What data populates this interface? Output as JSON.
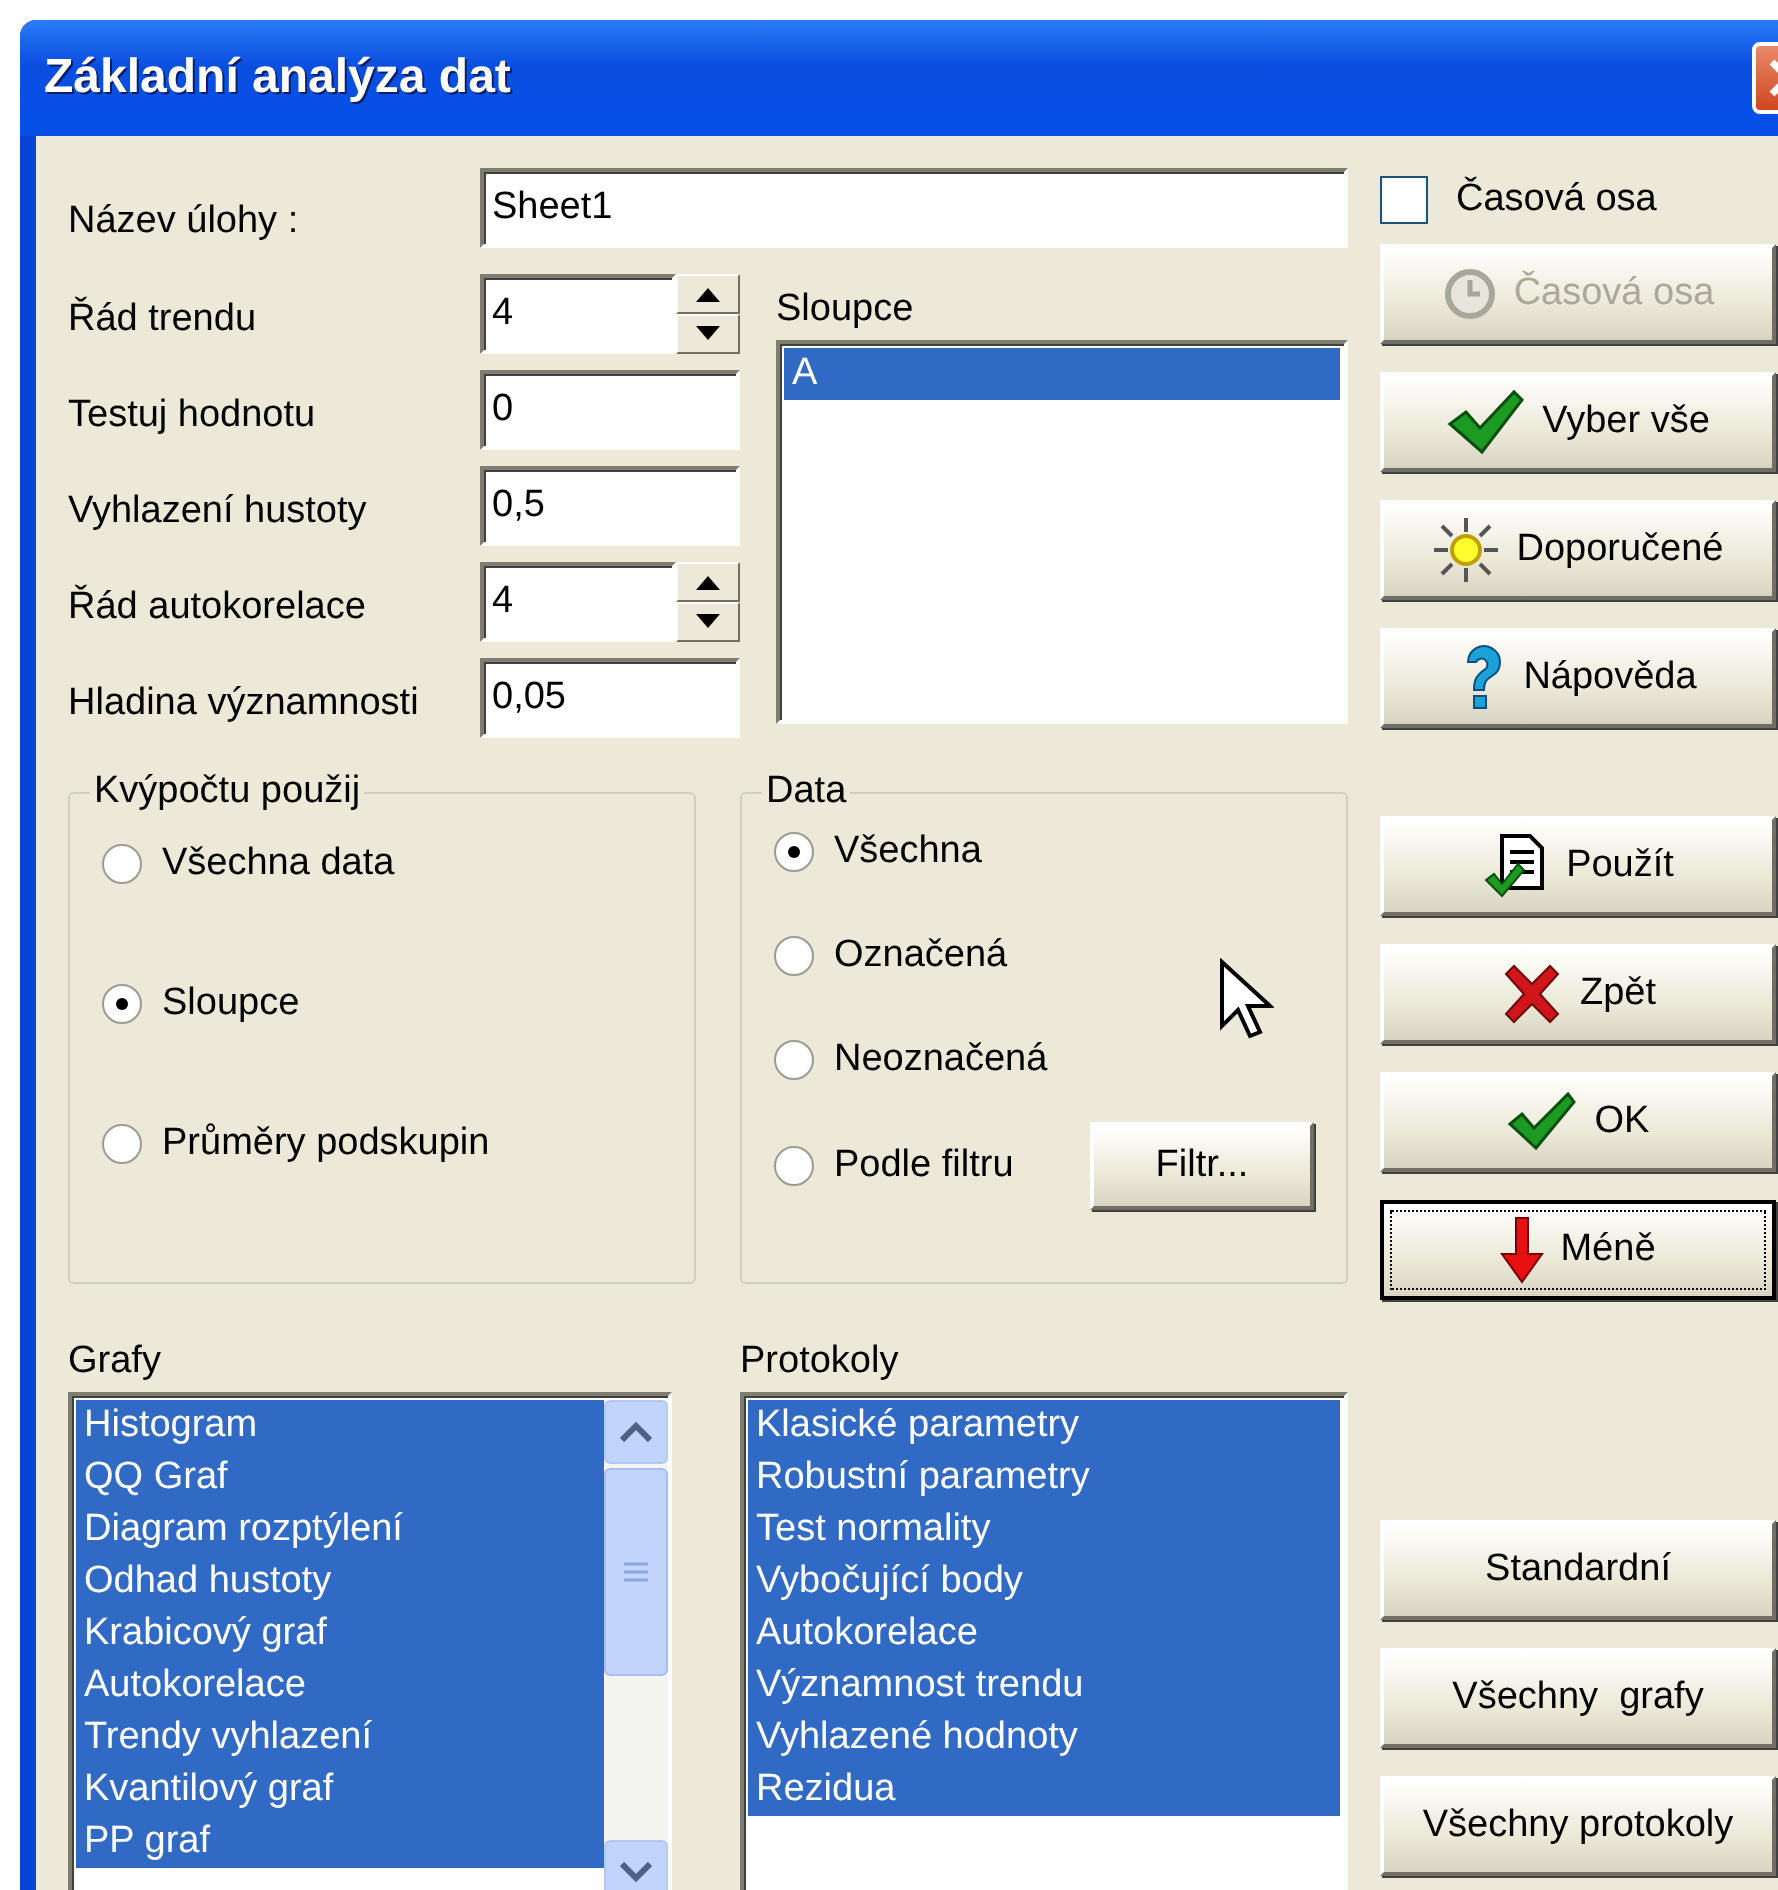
{
  "window": {
    "title": "Základní analýza dat"
  },
  "task_name": {
    "label": "Název úlohy :",
    "value": "Sheet1"
  },
  "fields": [
    {
      "label": "Řád trendu",
      "value": "4",
      "kind": "spin"
    },
    {
      "label": "Testuj hodnotu",
      "value": "0",
      "kind": "text"
    },
    {
      "label": "Vyhlazení hustoty",
      "value": "0,5",
      "kind": "text"
    },
    {
      "label": "Řád autokorelace",
      "value": "4",
      "kind": "spin"
    },
    {
      "label": "Hladina významnosti",
      "value": "0,05",
      "kind": "text"
    }
  ],
  "columns": {
    "label": "Sloupce",
    "items": [
      {
        "label": "A",
        "selected": true
      }
    ]
  },
  "compute_group": {
    "title": "Kvýpočtu použij",
    "options": [
      {
        "label": "Všechna data",
        "selected": false
      },
      {
        "label": "Sloupce",
        "selected": true
      },
      {
        "label": "Průměry podskupin",
        "selected": false
      }
    ]
  },
  "data_group": {
    "title": "Data",
    "options": [
      {
        "label": "Všechna",
        "selected": true
      },
      {
        "label": "Označená",
        "selected": false
      },
      {
        "label": "Neoznačená",
        "selected": false
      },
      {
        "label": "Podle filtru",
        "selected": false
      }
    ],
    "filter_button": {
      "label": "Filtr..."
    }
  },
  "graphs": {
    "label": "Grafy",
    "items": [
      {
        "label": "Histogram",
        "selected": true
      },
      {
        "label": "QQ Graf",
        "selected": true
      },
      {
        "label": "Diagram rozptýlení",
        "selected": true
      },
      {
        "label": "Odhad hustoty",
        "selected": true
      },
      {
        "label": "Krabicový graf",
        "selected": true
      },
      {
        "label": "Autokorelace",
        "selected": true
      },
      {
        "label": "Trendy vyhlazení",
        "selected": true
      },
      {
        "label": "Kvantilový graf",
        "selected": true
      },
      {
        "label": "PP graf",
        "selected": true
      }
    ]
  },
  "protocols": {
    "label": "Protokoly",
    "items": [
      {
        "label": "Klasické parametry",
        "selected": true
      },
      {
        "label": "Robustní parametry",
        "selected": true
      },
      {
        "label": "Test normality",
        "selected": true
      },
      {
        "label": "Vybočující body",
        "selected": true
      },
      {
        "label": "Autokorelace",
        "selected": true
      },
      {
        "label": "Významnost trendu",
        "selected": true
      },
      {
        "label": "Vyhlazené hodnoty",
        "selected": true
      },
      {
        "label": "Rezidua",
        "selected": true
      }
    ]
  },
  "time_axis": {
    "label": "Časová osa",
    "checked": false
  },
  "top_buttons": [
    {
      "label": "Časová osa",
      "disabled": true,
      "focused": false
    },
    {
      "label": "Vyber vše",
      "disabled": false,
      "focused": false
    },
    {
      "label": "Doporučené",
      "disabled": false,
      "focused": false
    },
    {
      "label": "Nápověda",
      "disabled": false,
      "focused": false
    }
  ],
  "action_buttons": [
    {
      "label": "Použít",
      "disabled": false,
      "focused": false
    },
    {
      "label": "Zpět",
      "disabled": false,
      "focused": false
    },
    {
      "label": "OK",
      "disabled": false,
      "focused": false
    },
    {
      "label": "Méně",
      "disabled": false,
      "focused": true
    }
  ],
  "bottom_buttons": [
    {
      "label": "Standardní",
      "disabled": false,
      "focused": false
    },
    {
      "label": "Všechny  grafy",
      "disabled": false,
      "focused": false
    },
    {
      "label": "Všechny protokoly",
      "disabled": false,
      "focused": false
    }
  ]
}
